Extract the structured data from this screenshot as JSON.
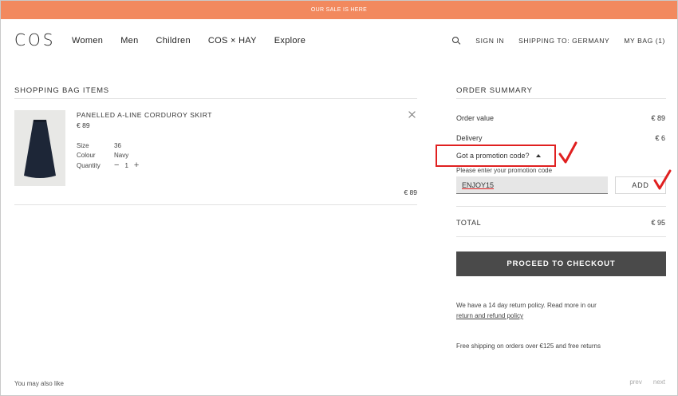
{
  "banner": {
    "text": "OUR SALE IS HERE"
  },
  "header": {
    "logo": "COS",
    "nav": [
      "Women",
      "Men",
      "Children",
      "COS × HAY",
      "Explore"
    ],
    "search_icon": "search-icon",
    "sign_in": "SIGN IN",
    "shipping_to": "SHIPPING TO:  GERMANY",
    "my_bag": "MY BAG (1)"
  },
  "bag": {
    "title": "SHOPPING BAG ITEMS",
    "item": {
      "name": "PANELLED A-LINE CORDUROY SKIRT",
      "price": "€ 89",
      "size_label": "Size",
      "size_value": "36",
      "colour_label": "Colour",
      "colour_value": "Navy",
      "quantity_label": "Quantity",
      "quantity_value": "1",
      "line_total": "€ 89"
    }
  },
  "summary": {
    "title": "ORDER SUMMARY",
    "order_value_label": "Order value",
    "order_value": "€ 89",
    "delivery_label": "Delivery",
    "delivery_value": "€ 6",
    "promo_toggle": "Got a promotion code?",
    "promo_hint": "Please enter your promotion code",
    "promo_code": "ENJOY15",
    "add_label": "ADD",
    "total_label": "TOTAL",
    "total_value": "€ 95",
    "checkout_label": "PROCEED TO CHECKOUT",
    "policy_text": "We have a 14 day return policy. Read more in our",
    "policy_link": "return and refund policy",
    "shipping_note": "Free shipping on orders over €125 and free returns"
  },
  "footer": {
    "also_like": "You may also like",
    "prev": "prev",
    "next": "next"
  },
  "colors": {
    "banner": "#f2895e",
    "checkout": "#4a4a4a",
    "annotation": "#e02020"
  }
}
